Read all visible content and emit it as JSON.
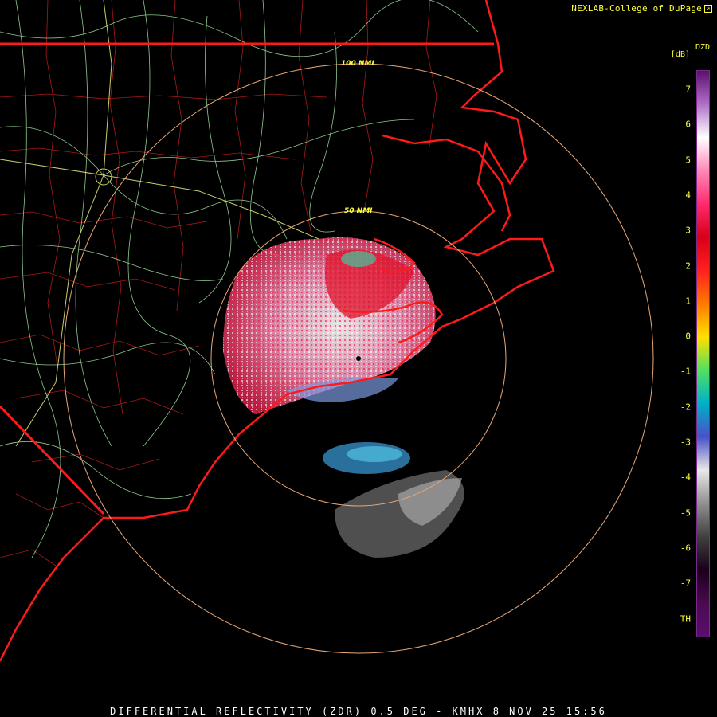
{
  "header": {
    "credit": "NEXLAB-College of DuPage",
    "link_icon": "external-link-icon"
  },
  "product": {
    "code": "DZD",
    "unit": "[dB]"
  },
  "footer": {
    "caption": "DIFFERENTIAL REFLECTIVITY (ZDR) 0.5 DEG - KMHX 8 NOV 25 15:56"
  },
  "range_rings": [
    {
      "label": "100 NMI"
    },
    {
      "label": "50 NMI"
    }
  ],
  "scale": {
    "ticks": [
      "7",
      "6",
      "5",
      "4",
      "3",
      "2",
      "1",
      "0",
      "-1",
      "-2",
      "-3",
      "-4",
      "-5",
      "-6",
      "-7",
      "TH"
    ],
    "colors_top_to_bottom": [
      "#5b0f6e",
      "#b070c8",
      "#ffffff",
      "#ff88b8",
      "#ff2a6e",
      "#d80018",
      "#ff2020",
      "#ff7a00",
      "#ffe000",
      "#50e060",
      "#00b0c8",
      "#4a50c8",
      "#e8e8e8",
      "#909090",
      "#404040",
      "#1a001a",
      "#4a0a50",
      "#5b0f6e"
    ]
  },
  "colors": {
    "background": "#000000",
    "coast_state": "#ff1a1a",
    "county": "#c81e1e",
    "highway": "#a0e0a0",
    "interstate": "#f0f080",
    "ring": "#e8a878",
    "label": "#ffff3c"
  }
}
